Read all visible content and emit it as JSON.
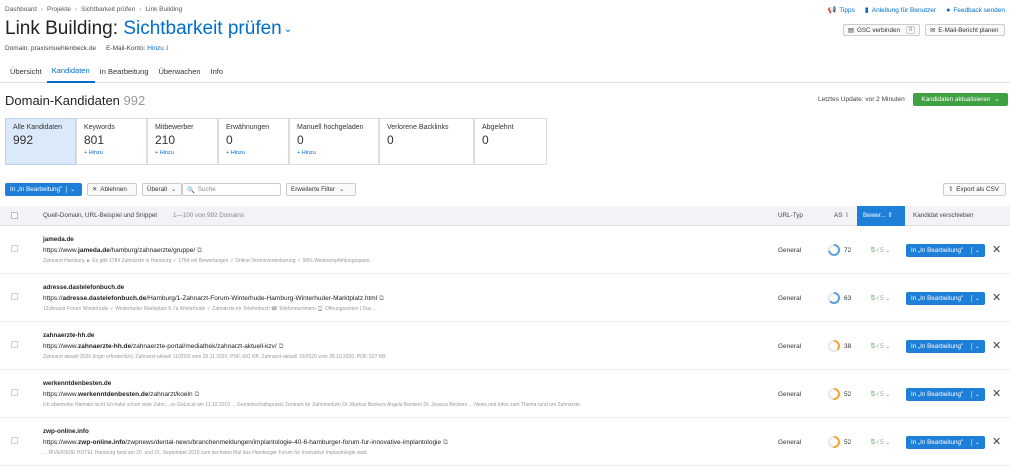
{
  "breadcrumb": [
    "Dashboard",
    "Projekte",
    "Sichtbarkeit prüfen",
    "Link Building"
  ],
  "top_links": [
    {
      "icon": "megaphone-icon",
      "label": "Tipps"
    },
    {
      "icon": "book-icon",
      "label": "Anleitung für Benutzer"
    },
    {
      "icon": "chat-icon",
      "label": "Feedback senden"
    }
  ],
  "title": {
    "prefix": "Link Building:",
    "project": "Sichtbarkeit prüfen"
  },
  "meta": {
    "domain_label": "Domain: praxismuehlenbeck.de",
    "email_label": "E-Mail-Konto:",
    "email_link": "Hinzu"
  },
  "header_buttons": {
    "gsc": "GSC verbinden",
    "gsc_count": "0",
    "email_report": "E-Mail-Bericht planen"
  },
  "tabs": [
    "Übersicht",
    "Kandidaten",
    "In Bearbeitung",
    "Überwachen",
    "Info"
  ],
  "section": {
    "title": "Domain-Kandidaten",
    "count": "992",
    "last_update": "Letztes Update: vor 2 Minuten",
    "update_button": "Kandidaten aktualisieren"
  },
  "cards": [
    {
      "label": "Alle Kandidaten",
      "value": "992",
      "add": ""
    },
    {
      "label": "Keywords",
      "value": "801",
      "add": "+ Hinzu"
    },
    {
      "label": "Mitbewerber",
      "value": "210",
      "add": "+ Hinzu"
    },
    {
      "label": "Erwähnungen",
      "value": "0",
      "add": "+ Hinzu"
    },
    {
      "label": "Manuell hochgeladen",
      "value": "0",
      "add": "+ Hinzu"
    },
    {
      "label": "Verlorene Backlinks",
      "value": "0",
      "add": ""
    },
    {
      "label": "Abgelehnt",
      "value": "0",
      "add": ""
    }
  ],
  "toolbar": {
    "move_button": "In „In Bearbeitung\"",
    "reject_button": "Ablehnen",
    "filter_select": "Überall",
    "search_placeholder": "Suche",
    "advanced_filter": "Erweiterte Filter",
    "export": "Export als CSV"
  },
  "table": {
    "headers": {
      "domain": "Quell-Domain, URL-Beispiel und Snippet",
      "range": "1—100 von 992 Domains",
      "type": "URL-Typ",
      "as": "AS",
      "rating": "Bewer...",
      "move": "Kandidat verschieben"
    },
    "rows": [
      {
        "domain": "jameda.de",
        "url_prefix": "https://www.",
        "url_bold": "jameda.de",
        "url_rest": "/hamburg/zahnaerzte/gruppe/",
        "snippet": "Zahnarzt Hamburg ► Es gibt 1784 Zahnärzte in Hamburg ✓ 1784 mit Bewertungen ✓ Online-Terminvereinbarung ✓ 99% Weiterempfehlungsquote.",
        "type": "General",
        "as": 72,
        "rating": "5",
        "rating_max": "/ 5",
        "action": "In „In Bearbeitung\""
      },
      {
        "domain": "adresse.dastelefonbuch.de",
        "url_prefix": "https://",
        "url_bold": "adresse.dastelefonbuch.de",
        "url_rest": "/Hamburg/1-Zahnarzt-Forum-Winterhude-Hamburg-Winterhuder-Marktplatz.html",
        "snippet": "1Zahnarzt Forum Winterhude ✓ Winterhuder Marktplatz 6-7a Winterhude ✓ Zahnärzte im Telefonbuch ☎ Telefonnummern ⌚ Öffnungszeiten | Das ...",
        "type": "General",
        "as": 63,
        "rating": "5",
        "rating_max": "/ 5",
        "action": "In „In Bearbeitung\""
      },
      {
        "domain": "zahnaerzte-hh.de",
        "url_prefix": "https://www.",
        "url_bold": "zahnaerzte-hh.de",
        "url_rest": "/zahnaerzte-portal/mediathek/zahnarzt-aktuell-kzv/",
        "snippet": "Zahnarzt aktuell 2020 (login erforderlich). Zahnarzt-aktuell 11/2020 vom 26.11.2020, PDF, 691 KB. Zahnarzt-aktuell 10/2020 vom 28.10.2020, PDF, 527 KB.",
        "type": "General",
        "as": 38,
        "rating": "5",
        "rating_max": "/ 5",
        "action": "In „In Bearbeitung\""
      },
      {
        "domain": "werkenntdenbesten.de",
        "url_prefix": "https://www.",
        "url_bold": "werkenntdenbesten.de",
        "url_rest": "/zahnarzt/koeln",
        "snippet": "Ich übertreibe Niemals nicht Ich habe schon viele Zahn... vo GoLocal am 11.10.2019 ... Gemeinschaftspraxis Zentrum für Zahnmedizin Dr. Markus Beckers Angela Beckers Dr. Jessica Beckers ... News und Infos zum Thema rund um Zahnärzte.",
        "type": "General",
        "as": 52,
        "rating": "5",
        "rating_max": "/ 5",
        "action": "In „In Bearbeitung\""
      },
      {
        "domain": "zwp-online.info",
        "url_prefix": "https://www.",
        "url_bold": "zwp-online.info",
        "url_rest": "/zwpnews/dental-news/branchenmeldungen/implantologie-40-6-hamburger-forum-fur-innovative-implantologie",
        "snippet": "... RIVERSIDE HOTEL Hamburg fand am 20. und 21. September 2019 zum sechsten Mal das Hamburger Forum für Innovative Implantologie statt.",
        "type": "General",
        "as": 52,
        "rating": "5",
        "rating_max": "/ 5",
        "action": "In „In Bearbeitung\""
      }
    ]
  },
  "colors": {
    "accent": "#006dca",
    "primary_button": "#1e7fd9",
    "green": "#3fa142",
    "as_high": "#5aa0e0",
    "as_mid": "#f0a830"
  }
}
